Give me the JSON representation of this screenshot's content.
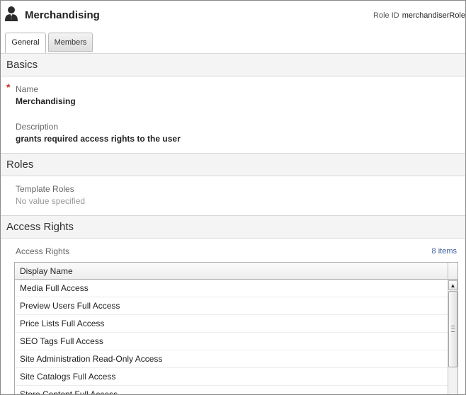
{
  "header": {
    "title": "Merchandising",
    "role_id_label": "Role ID",
    "role_id_value": "merchandiserRole"
  },
  "tabs": [
    {
      "label": "General",
      "active": true
    },
    {
      "label": "Members",
      "active": false
    }
  ],
  "basics": {
    "heading": "Basics",
    "name_label": "Name",
    "name_value": "Merchandising",
    "description_label": "Description",
    "description_value": "grants required access rights to the user"
  },
  "roles": {
    "heading": "Roles",
    "template_roles_label": "Template Roles",
    "template_roles_value": "No value specified"
  },
  "access_rights": {
    "heading": "Access Rights",
    "label": "Access Rights",
    "count": "8 items",
    "column_header": "Display Name",
    "rows": [
      "Media Full Access",
      "Preview Users Full Access",
      "Price Lists Full Access",
      "SEO Tags Full Access",
      "Site Administration Read-Only Access",
      "Site Catalogs Full Access",
      "Store Content Full Access"
    ]
  },
  "colors": {
    "required": "#d0302a",
    "link": "#3a5d9a",
    "section_bg": "#f4f4f4"
  }
}
